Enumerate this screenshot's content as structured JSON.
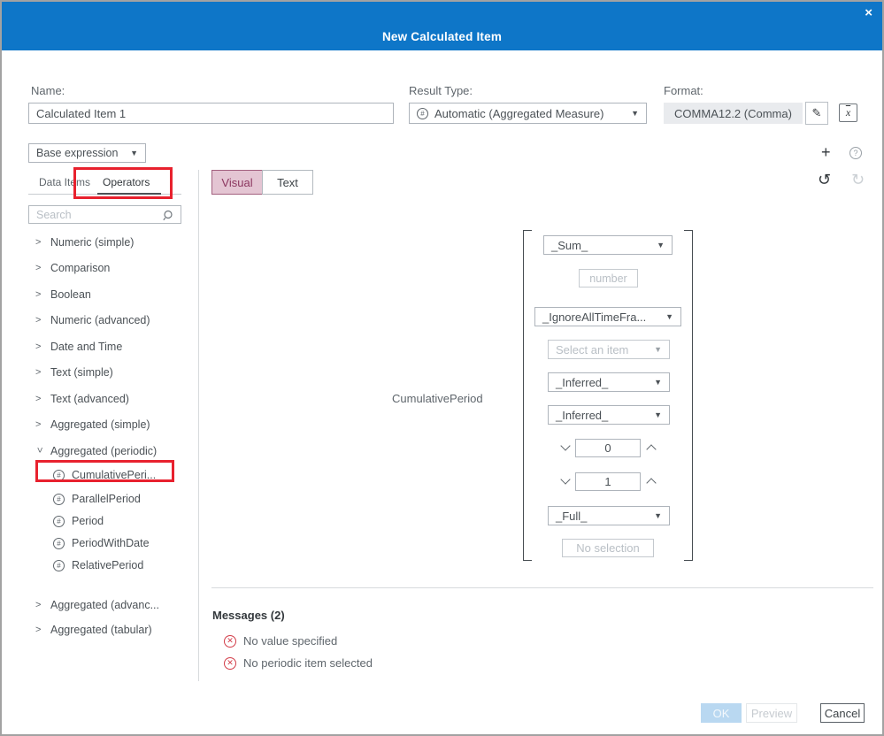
{
  "dialog": {
    "title": "New Calculated Item",
    "close_icon": "×"
  },
  "form": {
    "name_label": "Name:",
    "name_value": "Calculated Item 1",
    "result_type_label": "Result Type:",
    "result_type_value": "Automatic (Aggregated Measure)",
    "format_label": "Format:",
    "format_value": "COMMA12.2 (Comma)"
  },
  "toolbar": {
    "expression_scope": "Base expression"
  },
  "left_panel": {
    "tabs": {
      "data_items": "Data Items",
      "operators": "Operators"
    },
    "search_placeholder": "Search",
    "items": [
      {
        "label": "Numeric (simple)"
      },
      {
        "label": "Comparison"
      },
      {
        "label": "Boolean"
      },
      {
        "label": "Numeric (advanced)"
      },
      {
        "label": "Date and Time"
      },
      {
        "label": "Text (simple)"
      },
      {
        "label": "Text (advanced)"
      },
      {
        "label": "Aggregated (simple)"
      },
      {
        "label": "Aggregated (periodic)"
      },
      {
        "label": "CumulativePeri..."
      },
      {
        "label": "ParallelPeriod"
      },
      {
        "label": "Period"
      },
      {
        "label": "PeriodWithDate"
      },
      {
        "label": "RelativePeriod"
      },
      {
        "label": "Aggregated (advanc..."
      },
      {
        "label": "Aggregated (tabular)"
      }
    ]
  },
  "editor": {
    "view_tabs": {
      "visual": "Visual",
      "text": "Text"
    },
    "function_label": "CumulativePeriod",
    "controls": {
      "aggregation": "_Sum_",
      "number_placeholder": "number",
      "time_frame": "_IgnoreAllTimeFra...",
      "item_placeholder": "Select an item",
      "interval_inner": "_Inferred_",
      "interval_outer": "_Inferred_",
      "offset_start": "0",
      "offset_end": "1",
      "scope": "_Full_",
      "selection_placeholder": "No selection"
    }
  },
  "messages": {
    "heading": "Messages (2)",
    "items": [
      {
        "text": "No value specified"
      },
      {
        "text": "No periodic item selected"
      }
    ]
  },
  "footer": {
    "ok": "OK",
    "preview": "Preview",
    "cancel": "Cancel"
  },
  "colors": {
    "header_blue": "#0e76c8",
    "annotation_red": "#e8212e",
    "visual_accent": "#8c3760"
  }
}
